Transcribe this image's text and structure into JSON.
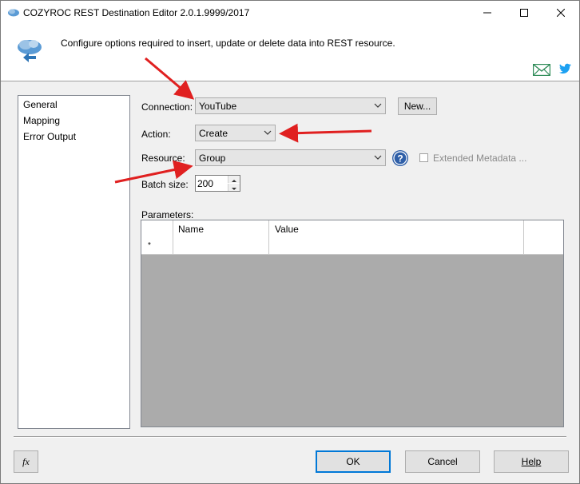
{
  "window": {
    "title": "COZYROC REST Destination Editor 2.0.1.9999/2017",
    "header_text": "Configure options required to insert, update or delete data into REST resource."
  },
  "nav": {
    "items": [
      "General",
      "Mapping",
      "Error Output"
    ]
  },
  "form": {
    "connection_label": "Connection:",
    "connection_value": "YouTube",
    "new_button": "New...",
    "action_label": "Action:",
    "action_value": "Create",
    "resource_label": "Resource:",
    "resource_value": "Group",
    "extended_metadata_label": "Extended Metadata ...",
    "batch_size_label": "Batch size:",
    "batch_size_value": "200"
  },
  "parameters": {
    "label": "Parameters:",
    "columns": [
      "Name",
      "Value"
    ],
    "new_row_marker": "*"
  },
  "footer": {
    "fx_label": "fx",
    "ok": "OK",
    "cancel": "Cancel",
    "help": "Help"
  },
  "colors": {
    "annotation_arrow": "#e02020",
    "accent": "#0078d7"
  }
}
